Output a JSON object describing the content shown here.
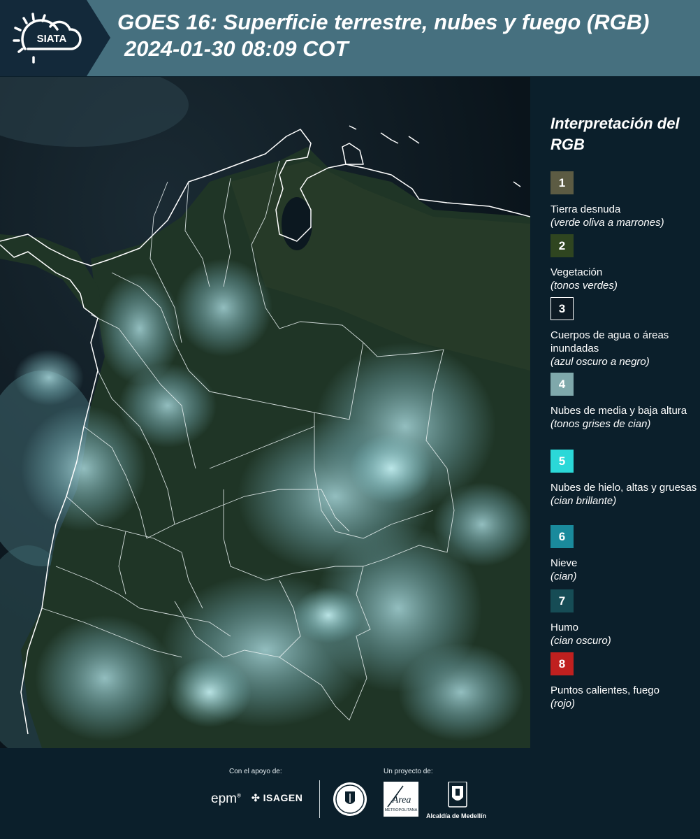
{
  "header": {
    "logo_text": "SIATA",
    "title_line1": "GOES 16: Superficie terrestre, nubes y fuego (RGB)",
    "title_line2": "2024-01-30 08:09 COT"
  },
  "legend": {
    "title": "Interpretación del RGB",
    "items": [
      {
        "num": "1",
        "name": "Tierra desnuda",
        "desc": "(verde oliva a marrones)",
        "color": "#5c5b43"
      },
      {
        "num": "2",
        "name": "Vegetación",
        "desc": "(tonos verdes)",
        "color": "#2f4520"
      },
      {
        "num": "3",
        "name": "Cuerpos de agua o áreas inundadas",
        "desc": "(azul oscuro a negro)",
        "color": "#0d1a24"
      },
      {
        "num": "4",
        "name": "Nubes de media y baja altura",
        "desc": "(tonos grises de cian)",
        "color": "#7fa8ab"
      },
      {
        "num": "5",
        "name": "Nubes de hielo, altas y gruesas",
        "desc": "(cian brillante)",
        "color": "#2bd8d8"
      },
      {
        "num": "6",
        "name": "Nieve",
        "desc": "(cian)",
        "color": "#1a8a9c"
      },
      {
        "num": "7",
        "name": "Humo",
        "desc": "(cian oscuro)",
        "color": "#164c55"
      },
      {
        "num": "8",
        "name": "Puntos calientes, fuego",
        "desc": "(rojo)",
        "color": "#c0201f"
      }
    ]
  },
  "footer": {
    "support_label": "Con el apoyo de:",
    "project_label": "Un proyecto de:",
    "epm": "epm",
    "isagen": "ISAGEN",
    "area_text": "Área",
    "area_sub": "METROPOLITANA",
    "alcaldia": "Alcaldía de Medellín"
  }
}
